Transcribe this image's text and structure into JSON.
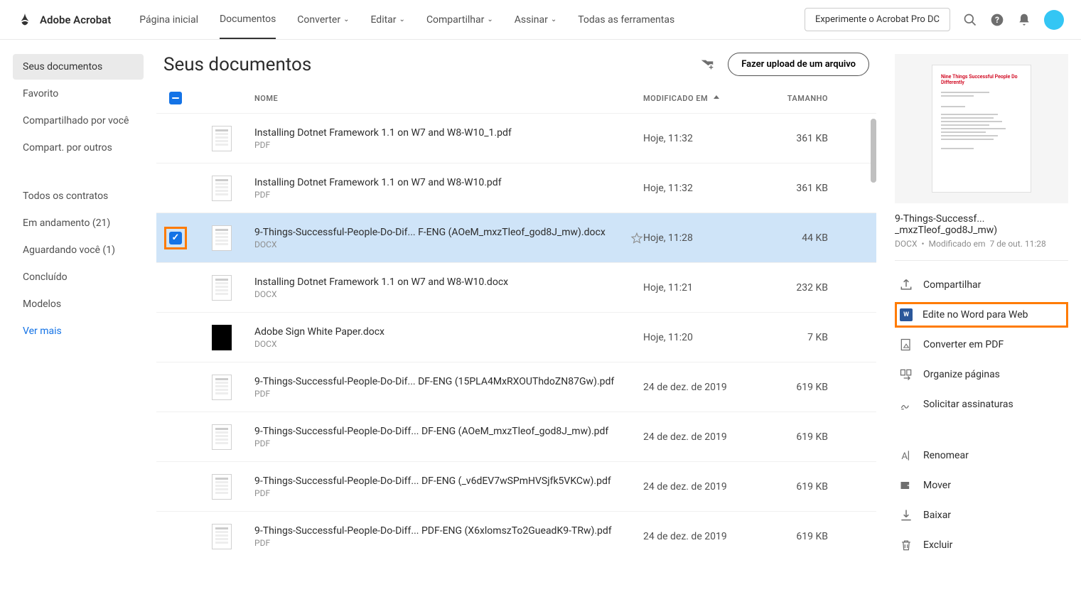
{
  "brand": "Adobe Acrobat",
  "nav": {
    "home": "Página inicial",
    "documents": "Documentos",
    "convert": "Converter",
    "edit": "Editar",
    "share": "Compartilhar",
    "sign": "Assinar",
    "all_tools": "Todas as ferramentas"
  },
  "promo": "Experimente o Acrobat Pro DC",
  "sidebar": {
    "your_docs": "Seus documentos",
    "favorite": "Favorito",
    "shared_by_you": "Compartilhado por você",
    "shared_by_others": "Compart. por outros",
    "all_contracts": "Todos os contratos",
    "in_progress": "Em andamento (21)",
    "awaiting_you": "Aguardando você (1)",
    "completed": "Concluído",
    "templates": "Modelos",
    "see_more": "Ver mais"
  },
  "page": {
    "title": "Seus documentos",
    "upload": "Fazer upload de um arquivo"
  },
  "columns": {
    "name": "NOME",
    "modified": "MODIFICADO EM",
    "size": "TAMANHO"
  },
  "rows": [
    {
      "name": "Installing Dotnet Framework 1.1 on W7 and W8-W10_1.pdf",
      "ext": "PDF",
      "date": "Hoje, 11:32",
      "size": "361 KB"
    },
    {
      "name": "Installing Dotnet Framework 1.1 on W7 and W8-W10.pdf",
      "ext": "PDF",
      "date": "Hoje, 11:32",
      "size": "361 KB"
    },
    {
      "name": "9-Things-Successful-People-Do-Dif... F-ENG (AOeM_mxzTleof_god8J_mw).docx",
      "ext": "DOCX",
      "date": "Hoje, 11:28",
      "size": "44 KB"
    },
    {
      "name": "Installing Dotnet Framework 1.1 on W7 and W8-W10.docx",
      "ext": "DOCX",
      "date": "Hoje, 11:21",
      "size": "232 KB"
    },
    {
      "name": "Adobe Sign White Paper.docx",
      "ext": "DOCX",
      "date": "Hoje, 11:20",
      "size": "7 KB"
    },
    {
      "name": "9-Things-Successful-People-Do-Dif... DF-ENG (15PLA4MxRXOUThdoZN87Gw).pdf",
      "ext": "PDF",
      "date": "24 de dez. de 2019",
      "size": "619 KB"
    },
    {
      "name": "9-Things-Successful-People-Do-Diff... DF-ENG (AOeM_mxzTleof_god8J_mw).pdf",
      "ext": "PDF",
      "date": "24 de dez. de 2019",
      "size": "619 KB"
    },
    {
      "name": "9-Things-Successful-People-Do-Diff... DF-ENG (_v6dEV7wSPmHVSjfk5VKCw).pdf",
      "ext": "PDF",
      "date": "24 de dez. de 2019",
      "size": "619 KB"
    },
    {
      "name": "9-Things-Successful-People-Do-Diff... PDF-ENG (X6xlomszTo2GueadK9-TRw).pdf",
      "ext": "PDF",
      "date": "24 de dez. de 2019",
      "size": "619 KB"
    }
  ],
  "detail": {
    "preview_title": "Nine Things Successful People Do Differently",
    "name": "9-Things-Successf... _mxzTleof_god8J_mw)",
    "ext": "DOCX",
    "modified_label": "Modificado em",
    "modified_value": "7 de out. 11:28",
    "actions": {
      "share": "Compartilhar",
      "edit_word": "Edite no Word para Web",
      "convert_pdf": "Converter em PDF",
      "organize": "Organize páginas",
      "request_sig": "Solicitar assinaturas",
      "rename": "Renomear",
      "move": "Mover",
      "download": "Baixar",
      "delete": "Excluir"
    }
  }
}
